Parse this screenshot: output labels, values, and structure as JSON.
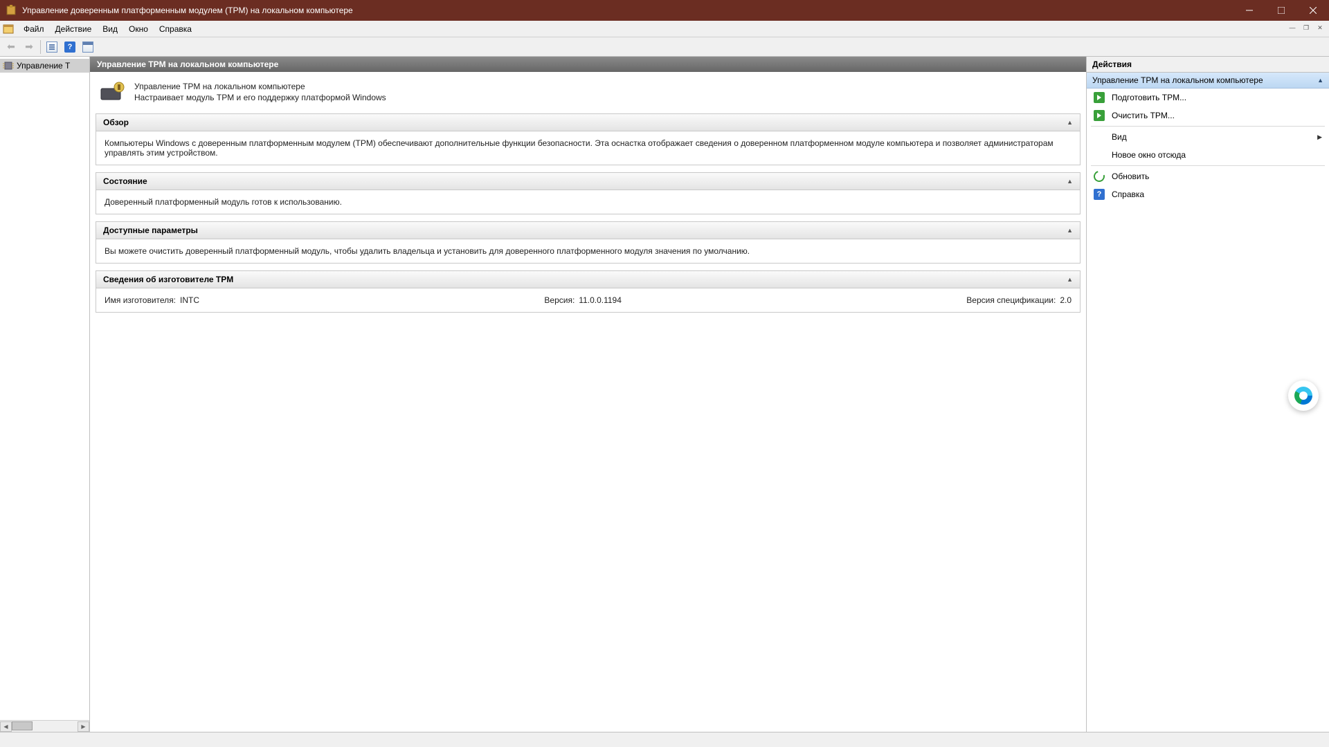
{
  "window": {
    "title": "Управление доверенным платформенным модулем (TPM) на локальном компьютере"
  },
  "menubar": {
    "file": "Файл",
    "action": "Действие",
    "view": "Вид",
    "window": "Окно",
    "help": "Справка"
  },
  "tree": {
    "root_label": "Управление T"
  },
  "center": {
    "title": "Управление TPM на локальном компьютере",
    "intro_line1": "Управление TPM на локальном компьютере",
    "intro_line2": "Настраивает модуль TPM и его поддержку платформой Windows",
    "panels": {
      "overview": {
        "title": "Обзор",
        "body": "Компьютеры Windows с доверенным платформенным модулем (TPM) обеспечивают дополнительные функции безопасности. Эта оснастка отображает сведения о доверенном платформенном модуле компьютера и позволяет администраторам управлять этим устройством."
      },
      "status": {
        "title": "Состояние",
        "body": "Доверенный платформенный модуль готов к использованию."
      },
      "options": {
        "title": "Доступные параметры",
        "body": "Вы можете очистить доверенный платформенный модуль, чтобы удалить владельца и установить для доверенного платформенного модуля значения по умолчанию."
      },
      "manufacturer": {
        "title": "Сведения об изготовителе TPM",
        "name_label": "Имя изготовителя:",
        "name_value": "INTC",
        "version_label": "Версия:",
        "version_value": "11.0.0.1194",
        "spec_label": "Версия спецификации:",
        "spec_value": "2.0"
      }
    }
  },
  "actions": {
    "pane_title": "Действия",
    "group_title": "Управление TPM на локальном компьютере",
    "items": {
      "prepare": "Подготовить TPM...",
      "clear": "Очистить TPM...",
      "view": "Вид",
      "new_window": "Новое окно отсюда",
      "refresh": "Обновить",
      "help": "Справка"
    }
  }
}
